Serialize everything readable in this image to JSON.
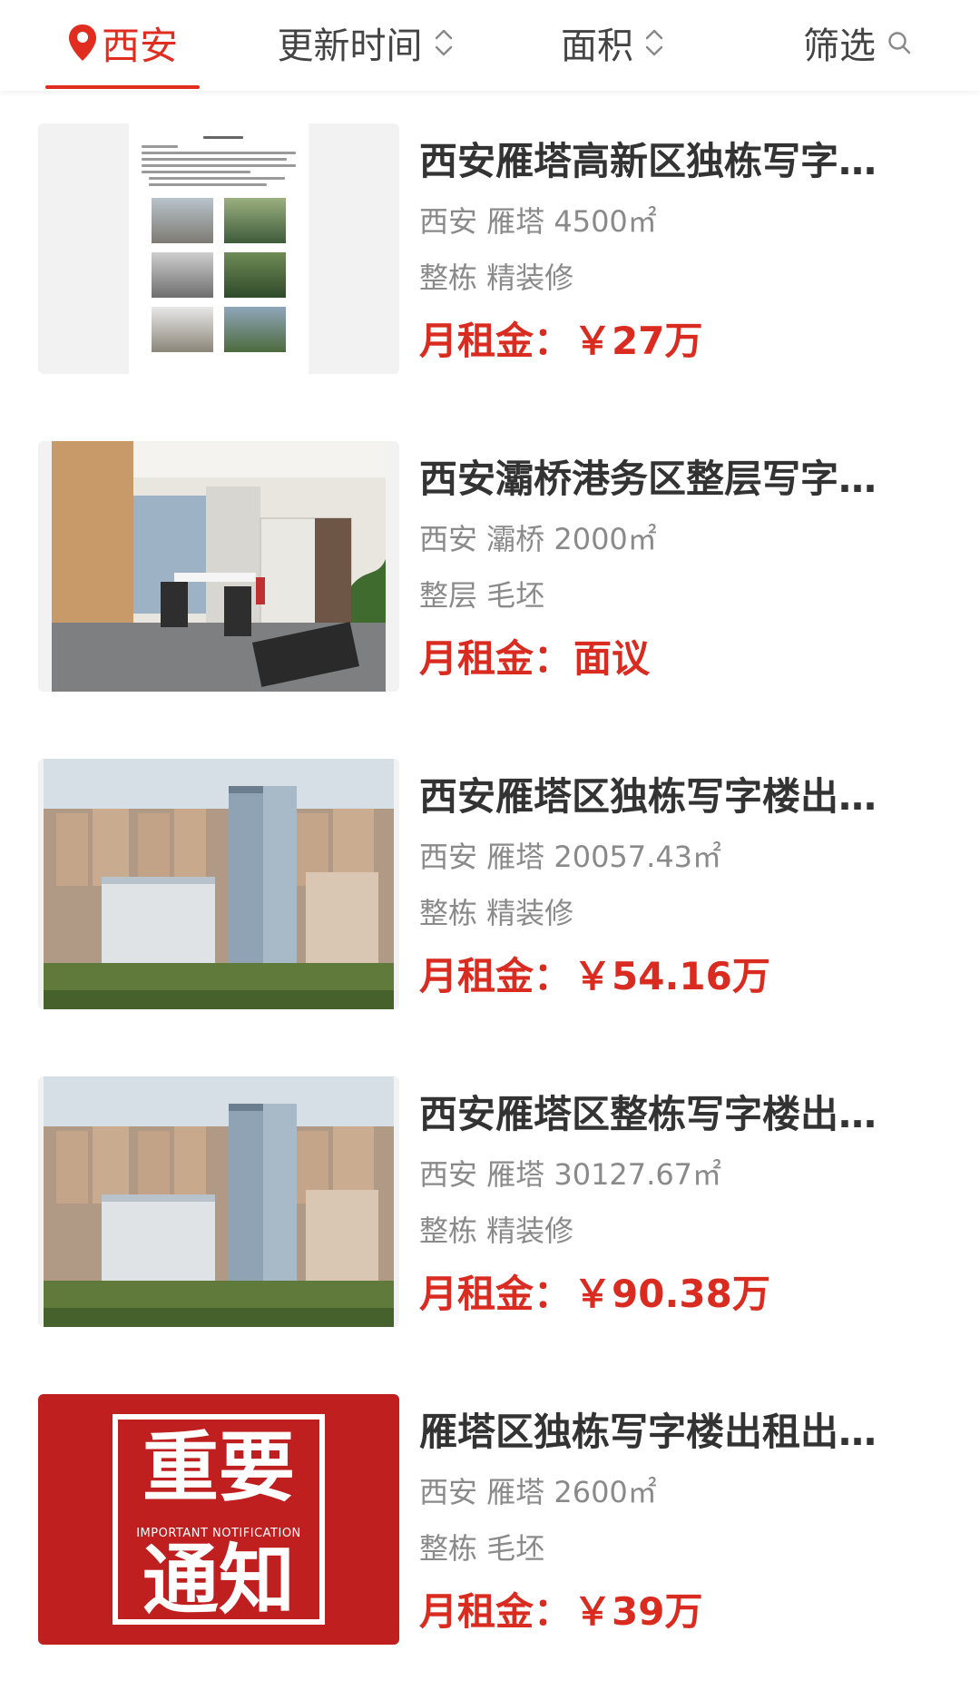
{
  "header": {
    "city": "西安",
    "sort_update_label": "更新时间",
    "sort_area_label": "面积",
    "filter_label": "筛选"
  },
  "colors": {
    "accent": "#e02d20",
    "price": "#d92b1f",
    "meta": "#8a8a8a",
    "title": "#333333"
  },
  "icons": {
    "city": "location-pin-icon",
    "sort": "sort-updown-icon",
    "filter": "search-icon"
  },
  "listings": [
    {
      "title": "西安雁塔高新区独栋写字…",
      "meta": "西安 雁塔 4500㎡",
      "tags": "整栋 精装修",
      "price_label": "月租金：",
      "price_value": "￥27万",
      "thumb": "document-thumb"
    },
    {
      "title": "西安灞桥港务区整层写字…",
      "meta": "西安 灞桥 2000㎡",
      "tags": "整层 毛坯",
      "price_label": "月租金：",
      "price_value": "面议",
      "thumb": "office-interior-thumb"
    },
    {
      "title": "西安雁塔区独栋写字楼出…",
      "meta": "西安 雁塔 20057.43㎡",
      "tags": "整栋 精装修",
      "price_label": "月租金：",
      "price_value": "￥54.16万",
      "thumb": "city-skyline-thumb"
    },
    {
      "title": "西安雁塔区整栋写字楼出…",
      "meta": "西安 雁塔 30127.67㎡",
      "tags": "整栋 精装修",
      "price_label": "月租金：",
      "price_value": "￥90.38万",
      "thumb": "city-skyline-thumb"
    },
    {
      "title": "雁塔区独栋写字楼出租出…",
      "meta": "西安 雁塔 2600㎡",
      "tags": "整栋 毛坯",
      "price_label": "月租金：",
      "price_value": "￥39万",
      "thumb": "notice-thumb",
      "thumb_text": {
        "line1": "重要",
        "sub": "IMPORTANT NOTIFICATION",
        "line2": "通知"
      }
    }
  ]
}
